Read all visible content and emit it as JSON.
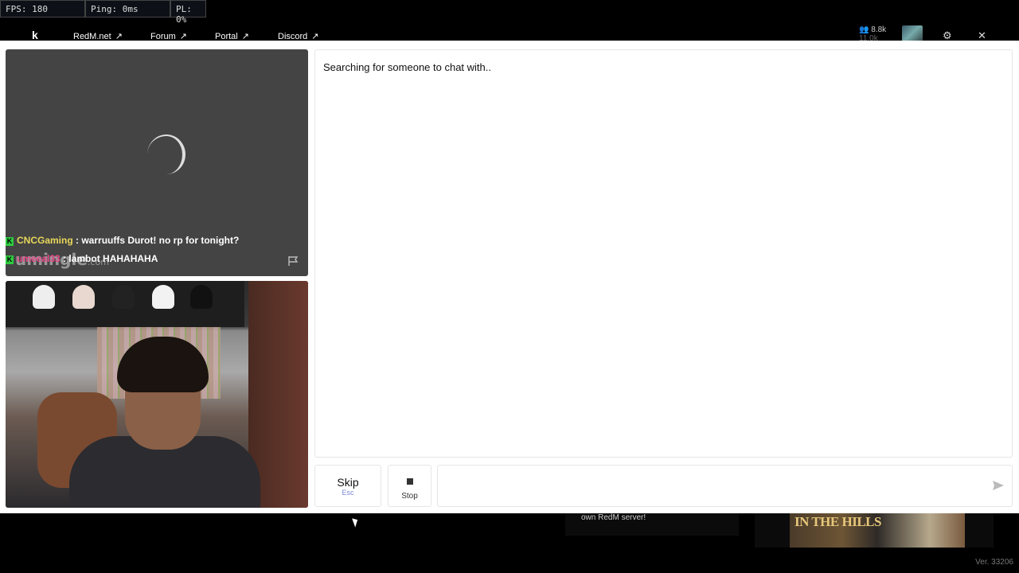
{
  "stats": {
    "fps": "FPS: 180",
    "ping": "Ping: 0ms",
    "pl": "PL: 0%"
  },
  "nav": {
    "logo": "k",
    "links": [
      {
        "label": "RedM.net",
        "arrow": "↗"
      },
      {
        "label": "Forum",
        "arrow": "↗"
      },
      {
        "label": "Portal",
        "arrow": "↗"
      },
      {
        "label": "Discord",
        "arrow": "↗"
      }
    ],
    "user_count": "8.8k",
    "user_count_sub": "11.0k"
  },
  "stranger_video": {
    "brand": "umingle",
    "brand_suffix": ".com",
    "chat": [
      {
        "name": "CNCGaming",
        "message": ": warruuffs Durot! no rp for tonight?"
      },
      {
        "name": "umeeal33",
        "message": ": lambot HAHAHAHA"
      }
    ]
  },
  "chat_panel": {
    "status": "Searching for someone to chat with.."
  },
  "controls": {
    "skip_label": "Skip",
    "skip_key": "Esc",
    "stop_label": "Stop",
    "message_value": ""
  },
  "bottom": {
    "promo_text": "own RedM server!",
    "ad_text": "IN THE HILLS",
    "version": "Ver. 33206"
  },
  "icons": {
    "users": "users-icon",
    "settings": "gear-icon",
    "close": "close-icon",
    "send": "send-icon",
    "flag": "flag-icon"
  }
}
